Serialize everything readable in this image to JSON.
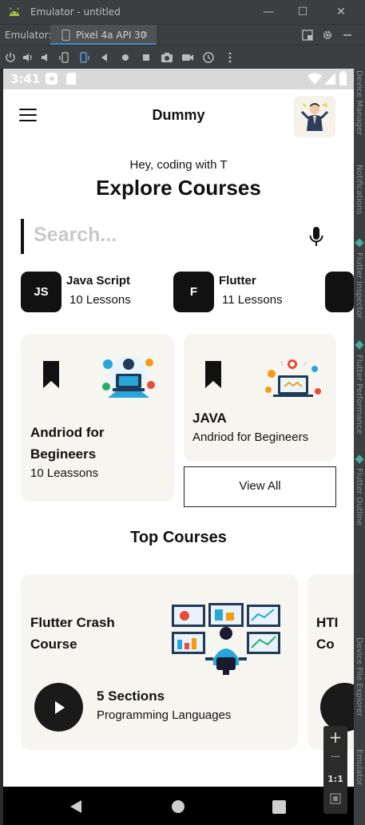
{
  "window": {
    "title": "Emulator - untitled",
    "controls": {
      "minimize": "—",
      "maximize": "☐",
      "close": "✕"
    }
  },
  "toolbar": {
    "label": "Emulator:",
    "tab_label": "Pixel 4a API 30",
    "tab_close": "×"
  },
  "side_panel": {
    "labels": [
      "Device Manager",
      "Notifications",
      "Flutter Inspector",
      "Flutter Performance",
      "Flutter Outline",
      "Device File Explorer",
      "Emulator"
    ]
  },
  "status_bar": {
    "time": "3:41"
  },
  "app": {
    "title": "Dummy",
    "greeting": "Hey, coding with T",
    "headline": "Explore Courses",
    "search_placeholder": "Search...",
    "categories": [
      {
        "initials": "JS",
        "name": "Java Script",
        "count": "10 Lessons"
      },
      {
        "initials": "F",
        "name": "Flutter",
        "count": "11 Lessons"
      }
    ],
    "featured": [
      {
        "title": "Andriod for Begineers",
        "subtitle": "10 Leassons"
      },
      {
        "title": "JAVA",
        "subtitle": "Andriod for Begineers"
      }
    ],
    "view_all": "View All",
    "top_courses_title": "Top Courses",
    "top_course": {
      "title": "Flutter Crash Course",
      "sections": "5 Sections",
      "category": "Programming Languages",
      "next_peek": "HTI Co"
    }
  },
  "zoom": {
    "plus": "+",
    "minus": "−",
    "ratio": "1:1"
  },
  "colors": {
    "accent": "#4a88c7",
    "card_bg": "#f7f5f0",
    "dark": "#111111",
    "ide_bg": "#3c3f41"
  }
}
